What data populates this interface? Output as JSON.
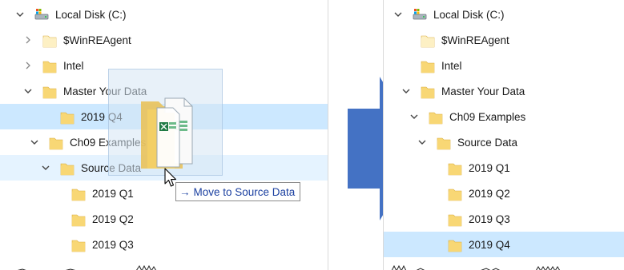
{
  "left": {
    "rows": [
      {
        "label": "Local Disk (C:)",
        "chevron": "down",
        "icon": "drive-icon"
      },
      {
        "label": "$WinREAgent",
        "chevron": "right",
        "icon": "folder-pale-icon"
      },
      {
        "label": "Intel",
        "chevron": "right",
        "icon": "folder-icon"
      },
      {
        "label": "Master Your Data",
        "chevron": "down",
        "icon": "folder-icon"
      },
      {
        "label": "2019 Q4",
        "chevron": "",
        "icon": "folder-icon",
        "state": "selected"
      },
      {
        "label": "Ch09 Examples",
        "chevron": "down",
        "icon": "folder-icon"
      },
      {
        "label": "Source Data",
        "chevron": "down",
        "icon": "folder-icon",
        "state": "drop-target"
      },
      {
        "label": "2019 Q1",
        "chevron": "",
        "icon": "folder-icon"
      },
      {
        "label": "2019 Q2",
        "chevron": "",
        "icon": "folder-icon"
      },
      {
        "label": "2019 Q3",
        "chevron": "",
        "icon": "folder-icon"
      }
    ]
  },
  "drag": {
    "tooltip_arrow": "→",
    "tooltip_text": "Move to Source Data",
    "ghost_icons": [
      "folder-icon",
      "excel-file-icon"
    ]
  },
  "transition_arrow_color": "#4472c4",
  "right": {
    "rows": [
      {
        "label": "Local Disk (C:)",
        "chevron": "down",
        "icon": "drive-icon"
      },
      {
        "label": "$WinREAgent",
        "chevron": "",
        "icon": "folder-pale-icon"
      },
      {
        "label": "Intel",
        "chevron": "",
        "icon": "folder-icon"
      },
      {
        "label": "Master Your Data",
        "chevron": "down",
        "icon": "folder-icon"
      },
      {
        "label": "Ch09 Examples",
        "chevron": "down",
        "icon": "folder-icon"
      },
      {
        "label": "Source Data",
        "chevron": "down",
        "icon": "folder-icon"
      },
      {
        "label": "2019 Q1",
        "chevron": "",
        "icon": "folder-icon"
      },
      {
        "label": "2019 Q2",
        "chevron": "",
        "icon": "folder-icon"
      },
      {
        "label": "2019 Q3",
        "chevron": "",
        "icon": "folder-icon"
      },
      {
        "label": "2019 Q4",
        "chevron": "",
        "icon": "folder-icon",
        "state": "selected"
      }
    ]
  },
  "colors": {
    "selection": "#cce8ff",
    "drop_target": "#e5f3ff",
    "folder": "#f8d775",
    "folder_pale": "#fdf0c4"
  }
}
